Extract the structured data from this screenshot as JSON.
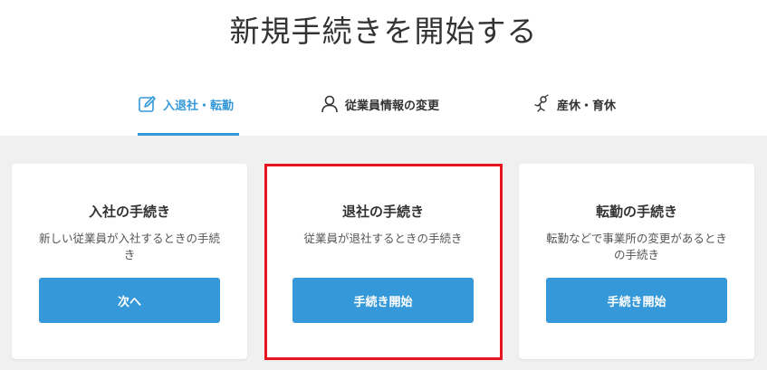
{
  "page": {
    "title": "新規手続きを開始する"
  },
  "tabs": [
    {
      "label": "入退社・転勤",
      "icon": "edit-icon",
      "active": true
    },
    {
      "label": "従業員情報の変更",
      "icon": "person-icon",
      "active": false
    },
    {
      "label": "産休・育休",
      "icon": "baby-icon",
      "active": false
    }
  ],
  "cards": [
    {
      "title": "入社の手続き",
      "description": "新しい従業員が入社するときの手続き",
      "button": "次へ"
    },
    {
      "title": "退社の手続き",
      "description": "従業員が退社するときの手続き",
      "button": "手続き開始",
      "highlighted": true
    },
    {
      "title": "転勤の手続き",
      "description": "転勤などで事業所の変更があるときの手続き",
      "button": "手続き開始"
    }
  ],
  "colors": {
    "accent": "#3598d8",
    "highlight": "#e8151e",
    "background": "#f0f0f0"
  }
}
